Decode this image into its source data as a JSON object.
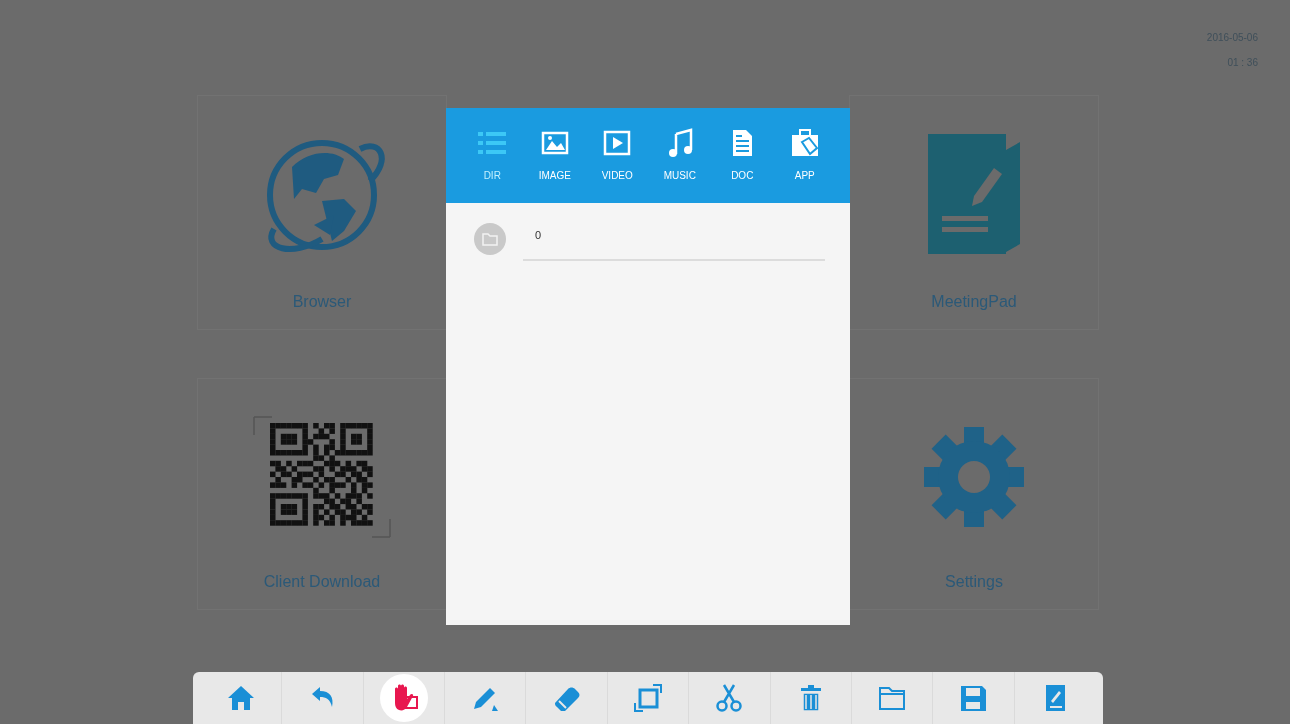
{
  "status": {
    "date": "2016-05-06",
    "time": "01 : 36"
  },
  "apps": [
    {
      "label": "Browser",
      "kind": "globe"
    },
    {
      "label": "MeetingPad",
      "kind": "notepad"
    },
    {
      "label": "Client Download",
      "kind": "qr"
    },
    {
      "label": "Settings",
      "kind": "gear"
    }
  ],
  "dialog": {
    "tabs": [
      {
        "label": "DIR",
        "kind": "list",
        "selected": true
      },
      {
        "label": "IMAGE",
        "kind": "image",
        "selected": false
      },
      {
        "label": "VIDEO",
        "kind": "video",
        "selected": false
      },
      {
        "label": "MUSIC",
        "kind": "music",
        "selected": false
      },
      {
        "label": "DOC",
        "kind": "doc",
        "selected": false
      },
      {
        "label": "APP",
        "kind": "app",
        "selected": false
      }
    ],
    "items": [
      {
        "name": "0"
      }
    ]
  },
  "toolbar": [
    {
      "kind": "home",
      "selected": false
    },
    {
      "kind": "undo",
      "selected": false
    },
    {
      "kind": "hand",
      "selected": true
    },
    {
      "kind": "pen",
      "selected": false
    },
    {
      "kind": "eraser",
      "selected": false
    },
    {
      "kind": "resize",
      "selected": false
    },
    {
      "kind": "scissors",
      "selected": false
    },
    {
      "kind": "trash",
      "selected": false
    },
    {
      "kind": "folder",
      "selected": false
    },
    {
      "kind": "save",
      "selected": false
    },
    {
      "kind": "note",
      "selected": false
    }
  ]
}
